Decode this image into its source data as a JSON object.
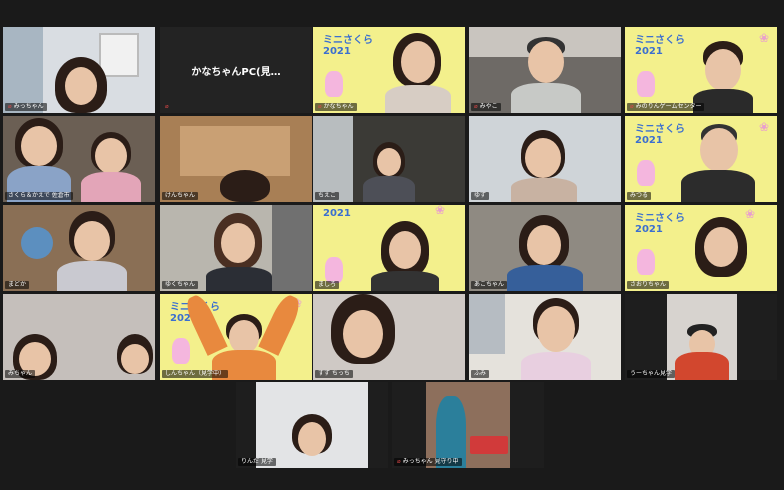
{
  "poster": {
    "title_line1": "ミニさくら",
    "title_line2": "2021"
  },
  "tiles": [
    {
      "name": "みっちゃん",
      "muted": true
    },
    {
      "name": "かなちゃんPC(見…",
      "muted": true,
      "camera_off": true
    },
    {
      "name": "かなちゃん",
      "muted": true
    },
    {
      "name": "みやこ",
      "muted": true
    },
    {
      "name": "みのりんゲームセンター",
      "muted": true
    },
    {
      "name": "さくら＆かえで 佐倉市",
      "muted": false
    },
    {
      "name": "けんちゃん",
      "muted": false
    },
    {
      "name": "ちえこ",
      "muted": false
    },
    {
      "name": "ゆず",
      "muted": false
    },
    {
      "name": "みつる",
      "muted": false
    },
    {
      "name": "まどか",
      "muted": false
    },
    {
      "name": "ゆくちゃん",
      "muted": false
    },
    {
      "name": "ましろ",
      "muted": false
    },
    {
      "name": "あこちゃん",
      "muted": false
    },
    {
      "name": "さおりちゃん",
      "muted": false
    },
    {
      "name": "みちゃん",
      "muted": false
    },
    {
      "name": "しんちゃん（見学中）",
      "muted": false
    },
    {
      "name": "すず ちっち",
      "muted": false
    },
    {
      "name": "ふみ",
      "muted": false
    },
    {
      "name": "うーちゃん見学",
      "muted": false
    },
    {
      "name": "りんだ 見学",
      "muted": false
    },
    {
      "name": "みっちゃん 見守り中",
      "muted": true
    }
  ]
}
